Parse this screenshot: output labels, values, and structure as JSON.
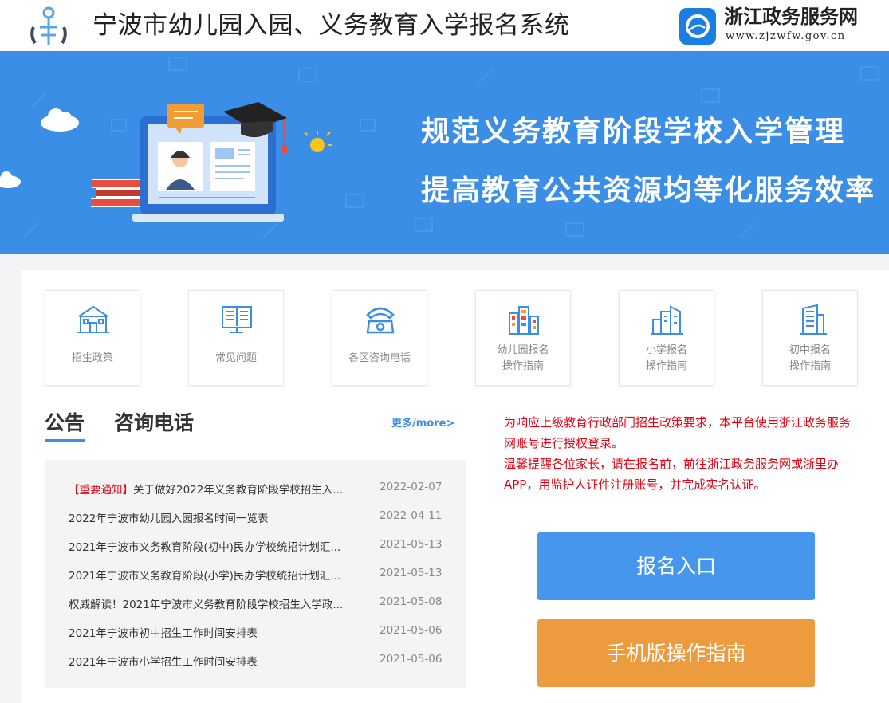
{
  "header": {
    "title": "宁波市幼儿园入园、义务教育入学报名系统",
    "partner_name": "浙江政务服务网",
    "partner_url": "www.zjzwfw.gov.cn"
  },
  "banner": {
    "line1": "规范义务教育阶段学校入学管理",
    "line2": "提高教育公共资源均等化服务效率"
  },
  "tiles": [
    {
      "label": "招生政策",
      "icon": "school-building-icon"
    },
    {
      "label": "常见问题",
      "icon": "open-book-monitor-icon"
    },
    {
      "label": "各区咨询电话",
      "icon": "telephone-icon"
    },
    {
      "label1": "幼儿园报名",
      "label2": "操作指南",
      "icon": "colorful-buildings-icon"
    },
    {
      "label1": "小学报名",
      "label2": "操作指南",
      "icon": "city-buildings-icon"
    },
    {
      "label1": "初中报名",
      "label2": "操作指南",
      "icon": "tall-building-icon"
    }
  ],
  "tabs": {
    "announcement": "公告",
    "hotline": "咨询电话",
    "more": "更多/more>"
  },
  "news": [
    {
      "tag": "【重要通知】",
      "title": "关于做好2022年义务教育阶段学校招生入...",
      "date": "2022-02-07"
    },
    {
      "tag": "",
      "title": "2022年宁波市幼儿园入园报名时间一览表",
      "date": "2022-04-11"
    },
    {
      "tag": "",
      "title": "2021年宁波市义务教育阶段(初中)民办学校统招计划汇...",
      "date": "2021-05-13"
    },
    {
      "tag": "",
      "title": "2021年宁波市义务教育阶段(小学)民办学校统招计划汇...",
      "date": "2021-05-13"
    },
    {
      "tag": "",
      "title": "权威解读！2021年宁波市义务教育阶段学校招生入学政...",
      "date": "2021-05-08"
    },
    {
      "tag": "",
      "title": "2021年宁波市初中招生工作时间安排表",
      "date": "2021-05-06"
    },
    {
      "tag": "",
      "title": "2021年宁波市小学招生工作时间安排表",
      "date": "2021-05-06"
    }
  ],
  "notice": {
    "line1": "为响应上级教育行政部门招生政策要求，本平台使用浙江政务服务网账号进行授权登录。",
    "line2": "温馨提醒各位家长，请在报名前，前往浙江政务服务网或浙里办APP，用监护人证件注册账号，并完成实名认证。"
  },
  "buttons": {
    "register": "报名入口",
    "mobile_guide": "手机版操作指南"
  },
  "colors": {
    "primary": "#3a8ee6",
    "orange": "#ec9c3e",
    "alert": "#e60012"
  }
}
